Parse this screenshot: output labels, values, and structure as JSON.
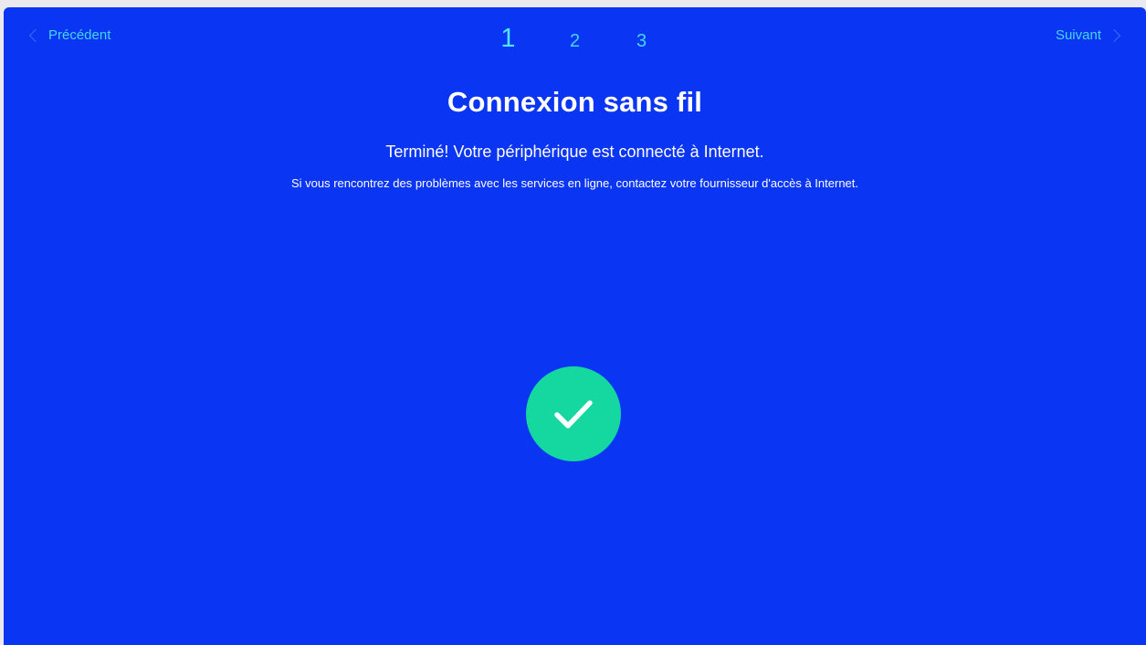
{
  "nav": {
    "previous_label": "Précédent",
    "next_label": "Suivant"
  },
  "steps": {
    "items": [
      "1",
      "2",
      "3"
    ],
    "current": 1
  },
  "content": {
    "title": "Connexion sans fil",
    "status_message": "Terminé! Votre périphérique est connecté à Internet.",
    "help_message": "Si vous rencontrez des problèmes avec les services en ligne, contactez votre fournisseur d'accès à Internet."
  },
  "status_icon": "checkmark-icon",
  "colors": {
    "background": "#0a35f2",
    "accent_text": "#45d6f2",
    "success": "#14d89f"
  }
}
